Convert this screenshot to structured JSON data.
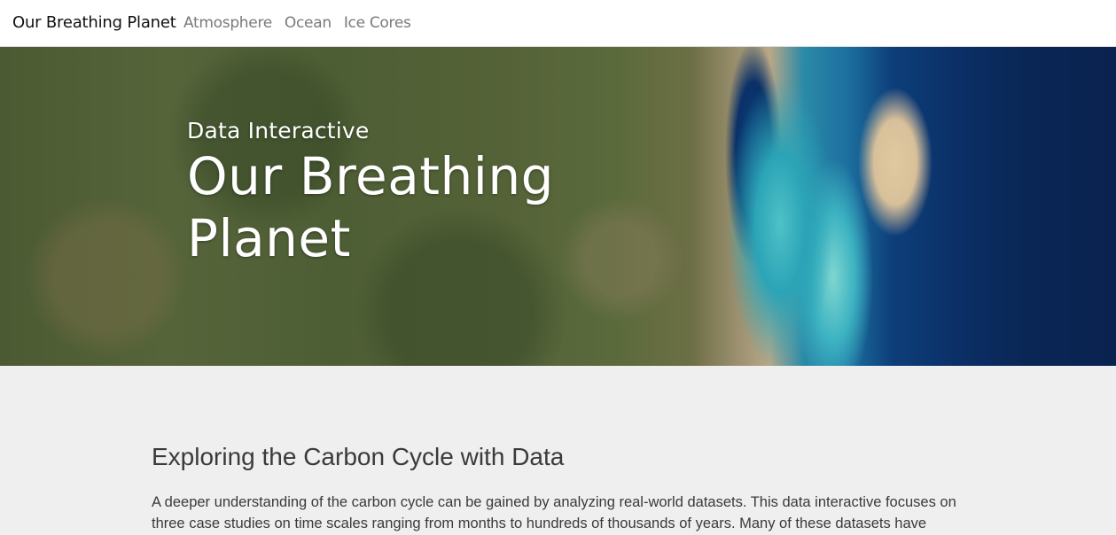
{
  "navbar": {
    "brand": "Our Breathing Planet",
    "links": [
      {
        "label": "Atmosphere"
      },
      {
        "label": "Ocean"
      },
      {
        "label": "Ice Cores"
      }
    ]
  },
  "hero": {
    "subtitle": "Data Interactive",
    "title": "Our Breathing Planet"
  },
  "main": {
    "heading": "Exploring the Carbon Cycle with Data",
    "intro": "A deeper understanding of the carbon cycle can be gained by analyzing real-world datasets. This data interactive focuses on three case studies on time scales ranging from months to hundreds of thousands of years. Many of these datasets have"
  },
  "colors": {
    "navbar_bg": "#ffffff",
    "page_bg": "#efefef",
    "nav_link": "#7a7a7a",
    "hero_text": "#ffffff",
    "body_text": "#3a3a3a"
  }
}
